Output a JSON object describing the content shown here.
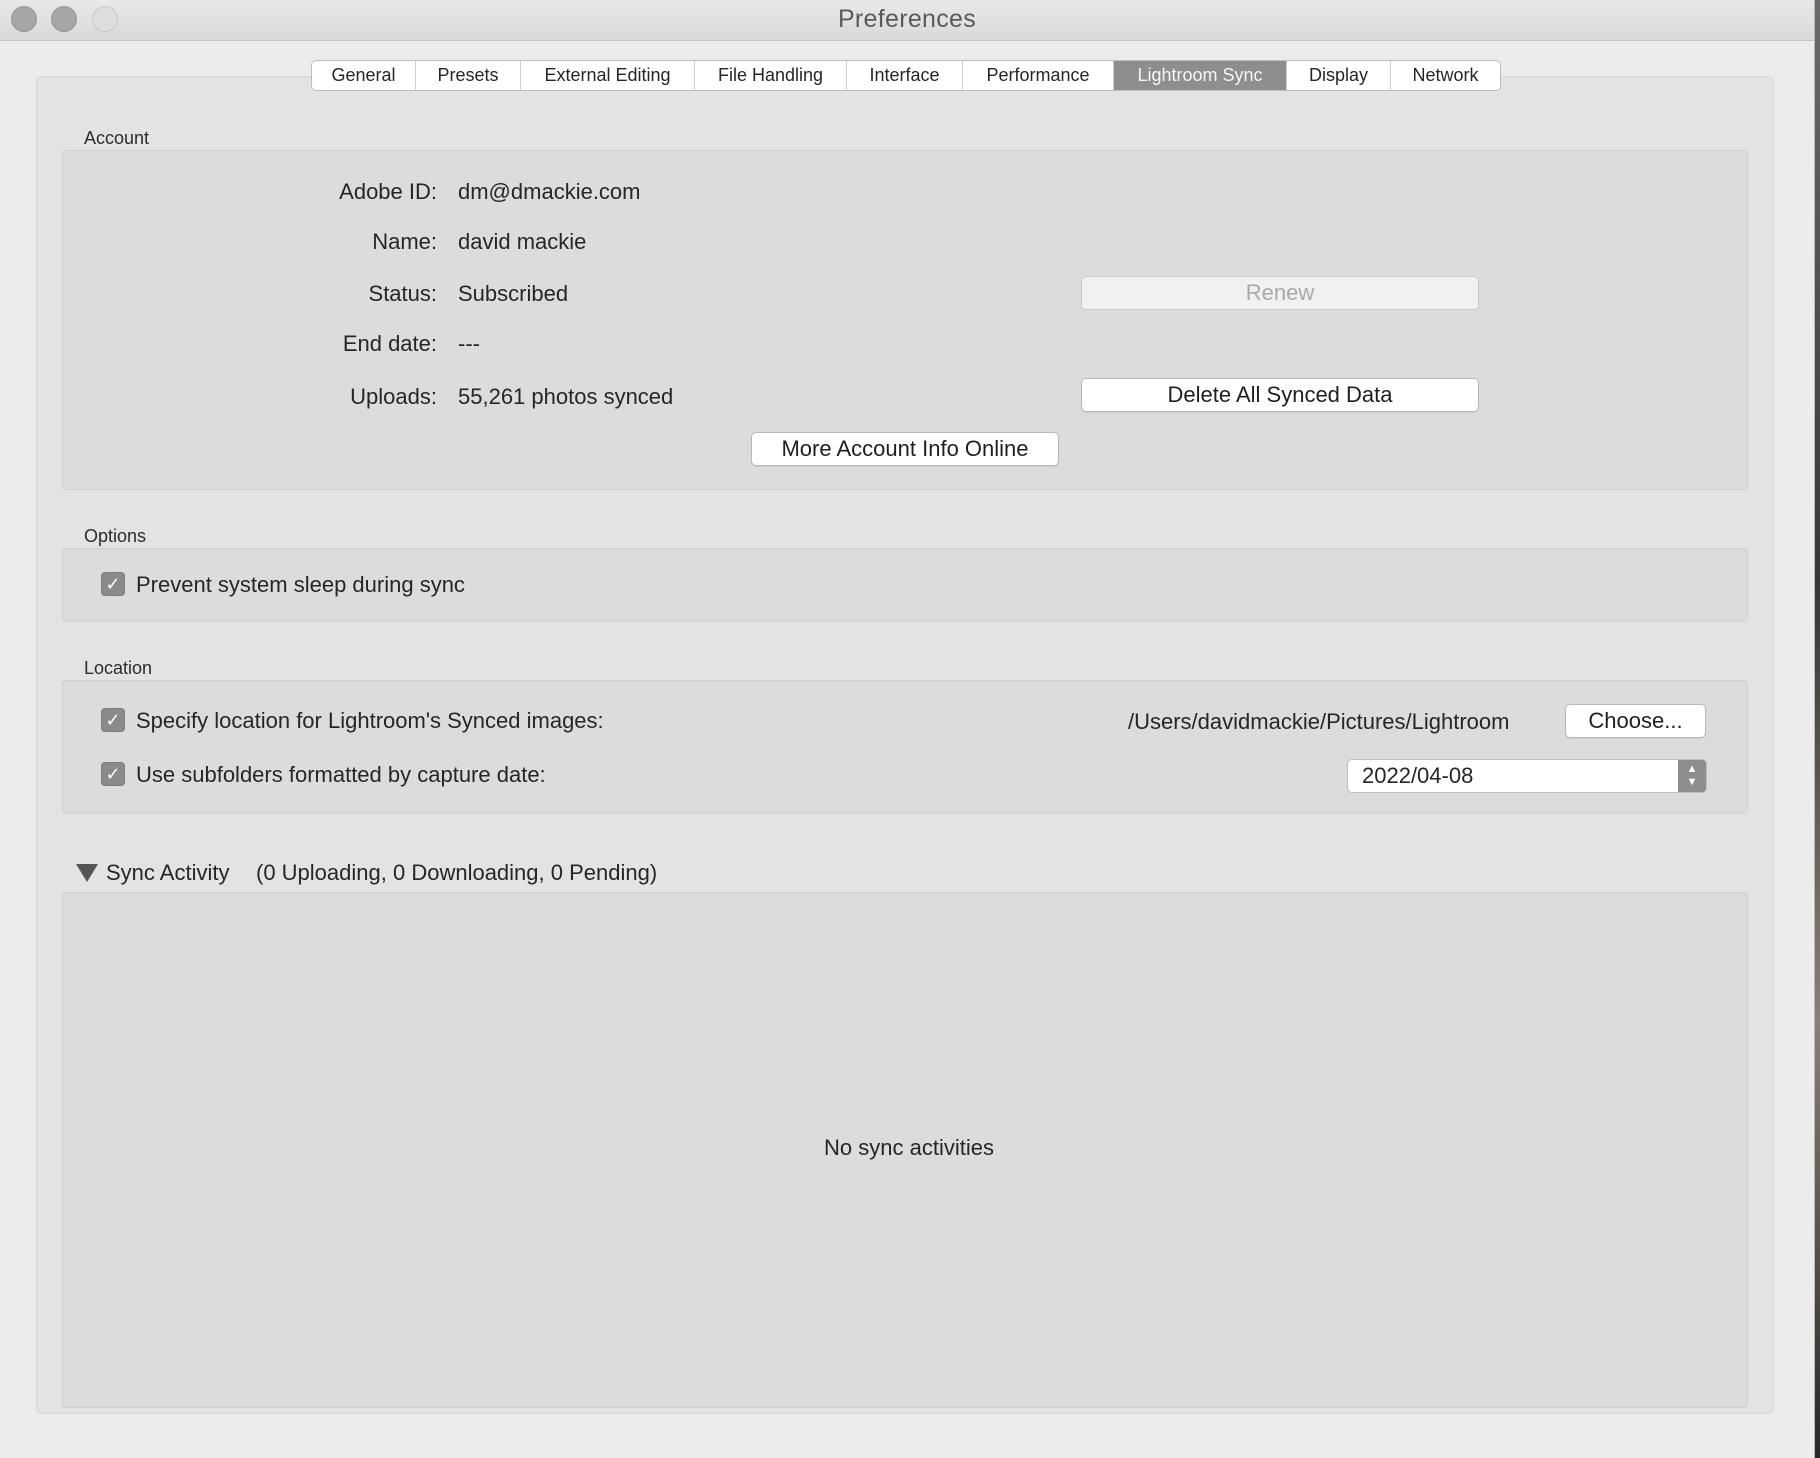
{
  "window": {
    "title": "Preferences"
  },
  "tabs": [
    {
      "label": "General",
      "active": false
    },
    {
      "label": "Presets",
      "active": false
    },
    {
      "label": "External Editing",
      "active": false
    },
    {
      "label": "File Handling",
      "active": false
    },
    {
      "label": "Interface",
      "active": false
    },
    {
      "label": "Performance",
      "active": false
    },
    {
      "label": "Lightroom Sync",
      "active": true
    },
    {
      "label": "Display",
      "active": false
    },
    {
      "label": "Network",
      "active": false
    }
  ],
  "account": {
    "section_label": "Account",
    "adobe_id_label": "Adobe ID:",
    "adobe_id": "dm@dmackie.com",
    "name_label": "Name:",
    "name": "david mackie",
    "status_label": "Status:",
    "status": "Subscribed",
    "end_date_label": "End date:",
    "end_date": "---",
    "uploads_label": "Uploads:",
    "uploads": "55,261 photos synced",
    "renew_label": "Renew",
    "delete_label": "Delete All Synced Data",
    "more_info_label": "More Account Info Online"
  },
  "options": {
    "section_label": "Options",
    "prevent_sleep_label": "Prevent system sleep during sync",
    "prevent_sleep_checked": true
  },
  "location": {
    "section_label": "Location",
    "specify_label": "Specify location for Lightroom's Synced images:",
    "specify_checked": true,
    "path": "/Users/davidmackie/Pictures/Lightroom",
    "choose_label": "Choose...",
    "subfolders_label": "Use subfolders formatted by capture date:",
    "subfolders_checked": true,
    "date_format": "2022/04-08"
  },
  "sync_activity": {
    "title": "Sync Activity",
    "summary": "(0 Uploading, 0 Downloading, 0 Pending)",
    "empty_message": "No sync activities"
  },
  "icons": {
    "checkmark": "✓",
    "stepper_up": "▲",
    "stepper_down": "▼"
  },
  "colors": {
    "active_tab": "#8e8e8e",
    "checkbox": "#8a8a8a"
  }
}
